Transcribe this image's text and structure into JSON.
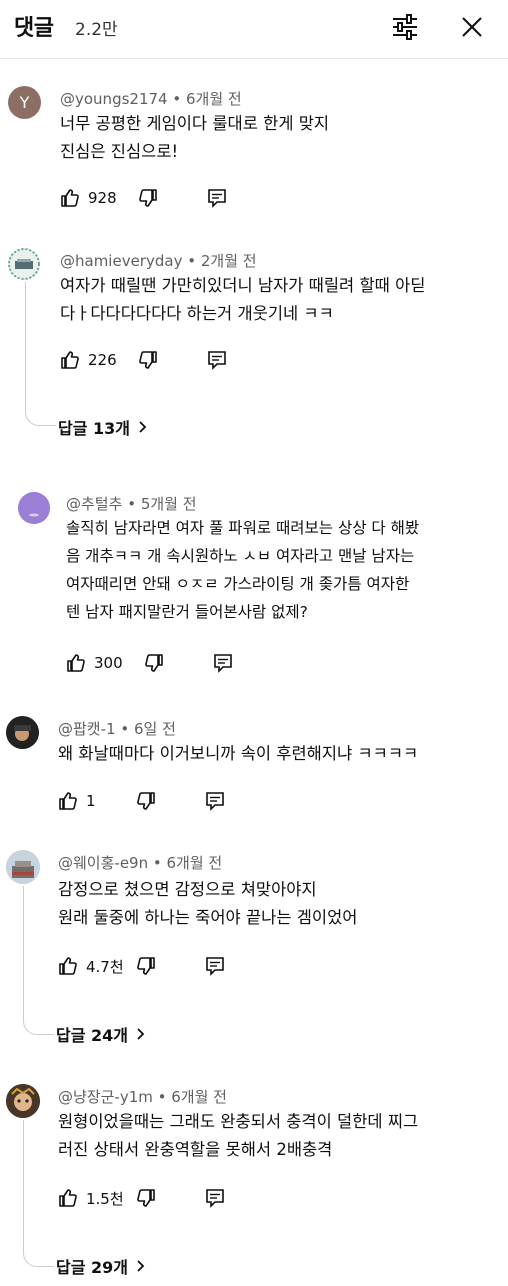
{
  "header": {
    "title": "댓글",
    "count": "2.2만",
    "filter_icon": "sliders-icon",
    "close_icon": "close-icon"
  },
  "comments": [
    {
      "author": "@youngs2174",
      "time": "6개월 전",
      "avatar_letter": "Y",
      "lines": [
        "너무 공평한 게임이다 룰대로 한게 맞지",
        "진심은 진심으로!"
      ],
      "likes": "928"
    },
    {
      "author": "@hamieveryday",
      "time": "2개월 전",
      "lines": [
        "여자가 때릴땐 가만히있더니 남자가 때릴려 할때 아딛",
        "다ㅏ다다다다다다 하는거 개웃기네 ㅋㅋ"
      ],
      "likes": "226",
      "replies": "답글 13개"
    },
    {
      "author": "@추털추",
      "time": "5개월 전",
      "lines": [
        "솔직히 남자라면 여자 풀 파워로 때려보는 상상 다 해봤",
        "음 개추ㅋㅋ 개 속시원하노 ㅅㅂ 여자라고 맨날 남자는",
        "여자때리면 안돼 ㅇㅈㄹ 가스라이팅 개 좆가틈 여자한",
        "텐 남자 패지말란거 들어본사람 없제?"
      ],
      "likes": "300"
    },
    {
      "author": "@팝캣-1",
      "time": "6일 전",
      "lines": [
        "왜 화날때마다 이거보니까 속이 후련해지냐 ㅋㅋㅋㅋ"
      ],
      "likes": "1"
    },
    {
      "author": "@웨이홍-e9n",
      "time": "6개월 전",
      "lines": [
        "감정으로 쳤으면 감정으로 쳐맞아야지",
        "원래 둘중에 하나는 죽어야 끝나는 겜이었어"
      ],
      "likes": "4.7천",
      "replies": "답글 24개"
    },
    {
      "author": "@냥장군-y1m",
      "time": "6개월 전",
      "lines": [
        "원형이었을때는 그래도 완충되서  충격이 덜한데 찌그",
        "러진 상태서 완충역할을 못해서 2배충격"
      ],
      "likes": "1.5천",
      "replies": "답글 29개"
    }
  ]
}
